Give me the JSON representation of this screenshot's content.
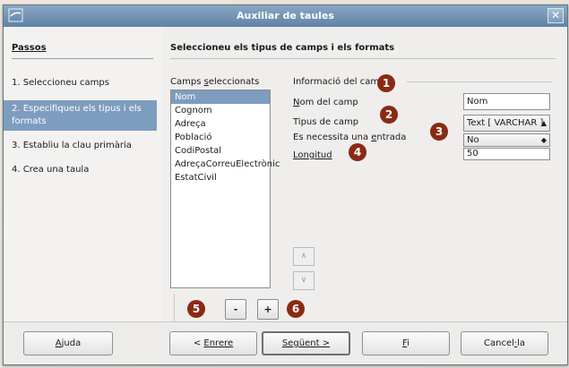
{
  "window": {
    "title": "Auxiliar de taules",
    "close_symbol": "✕"
  },
  "steps": {
    "title": "Passos",
    "items": [
      {
        "label": "1. Seleccioneu camps"
      },
      {
        "label": "2. Especifiqueu els tipus i els formats"
      },
      {
        "label": "3. Establiu la clau primària"
      },
      {
        "label": "4. Crea una taula"
      }
    ]
  },
  "main": {
    "title": "Seleccioneu els tipus de camps i els formats",
    "fields_list": {
      "label_pre": "Camps ",
      "label_mnemonic": "s",
      "label_post": "eleccionats",
      "items": [
        "Nom",
        "Cognom",
        "Adreça",
        "Població",
        "CodiPostal",
        "AdreçaCorreuElectrònic",
        "EstatCivil"
      ],
      "selected_index": 0
    },
    "field_info": {
      "section_label": "Informació del camp",
      "name_label_mnemonic": "N",
      "name_label_rest": "om del camp",
      "name_value": "Nom",
      "type_label": "Tipus de camp",
      "type_value": "Text [ VARCHAR ]",
      "required_label_pre": "Es necessita una ",
      "required_label_mnemonic": "e",
      "required_label_post": "ntrada",
      "required_value": "No",
      "length_label_mnemonic": "L",
      "length_label_rest": "ongitud",
      "length_value": "50"
    },
    "move_up_symbol": "∧",
    "move_down_symbol": "∨",
    "remove_symbol": "-",
    "add_symbol": "+"
  },
  "badges": [
    "1",
    "2",
    "3",
    "4",
    "5",
    "6"
  ],
  "buttons": {
    "help_mnemonic": "A",
    "help_rest": "juda",
    "back_pre": "< ",
    "back_mnemonic": "E",
    "back_rest": "nrere",
    "next_pre": "Se",
    "next_mnemonic": "g",
    "next_rest": "üent >",
    "finish_mnemonic": "F",
    "finish_rest": "i",
    "cancel_pre": "Cancel",
    "cancel_mnemonic": "·",
    "cancel_rest": "la"
  },
  "colors": {
    "accent": "#7d9dbf",
    "badge": "#8b2a14",
    "titlebar": "#6f8fb2"
  }
}
